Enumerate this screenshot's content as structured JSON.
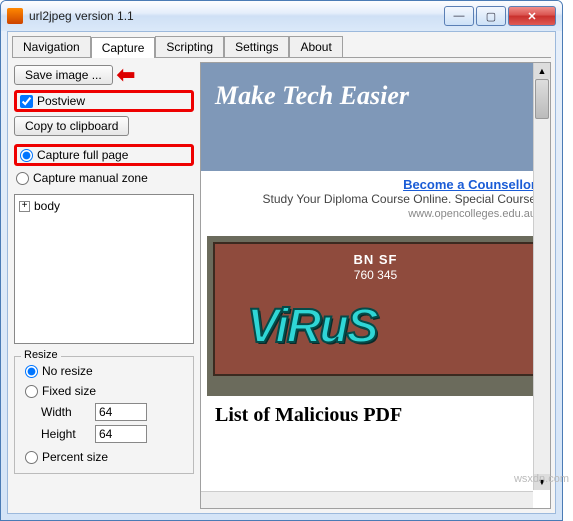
{
  "window": {
    "title": "url2jpeg version 1.1"
  },
  "tabs": [
    "Navigation",
    "Capture",
    "Scripting",
    "Settings",
    "About"
  ],
  "active_tab": "Capture",
  "buttons": {
    "save_image": "Save image ...",
    "copy_clipboard": "Copy to clipboard"
  },
  "checkboxes": {
    "postview": {
      "label": "Postview",
      "checked": true
    }
  },
  "radios": {
    "capture_full": {
      "label": "Capture full page",
      "selected": true
    },
    "capture_manual": {
      "label": "Capture manual zone",
      "selected": false
    },
    "no_resize": {
      "label": "No resize",
      "selected": true
    },
    "fixed_size": {
      "label": "Fixed size",
      "selected": false
    },
    "percent_size": {
      "label": "Percent size",
      "selected": false
    }
  },
  "tree": {
    "root": "body"
  },
  "resize": {
    "legend": "Resize",
    "width_label": "Width",
    "width_value": "64",
    "height_label": "Height",
    "height_value": "64"
  },
  "preview": {
    "hero": "Make Tech Easier",
    "ad_link": "Become a Counsellor",
    "ad_text": "Study Your Diploma Course Online. Special Course",
    "ad_domain": "www.opencolleges.edu.au",
    "boxcar_rail": "BN  SF",
    "boxcar_num": "760  345",
    "graffiti": "ViRuS",
    "bottom_heading": "List of Malicious PDF"
  },
  "watermark": "wsxdn.com"
}
